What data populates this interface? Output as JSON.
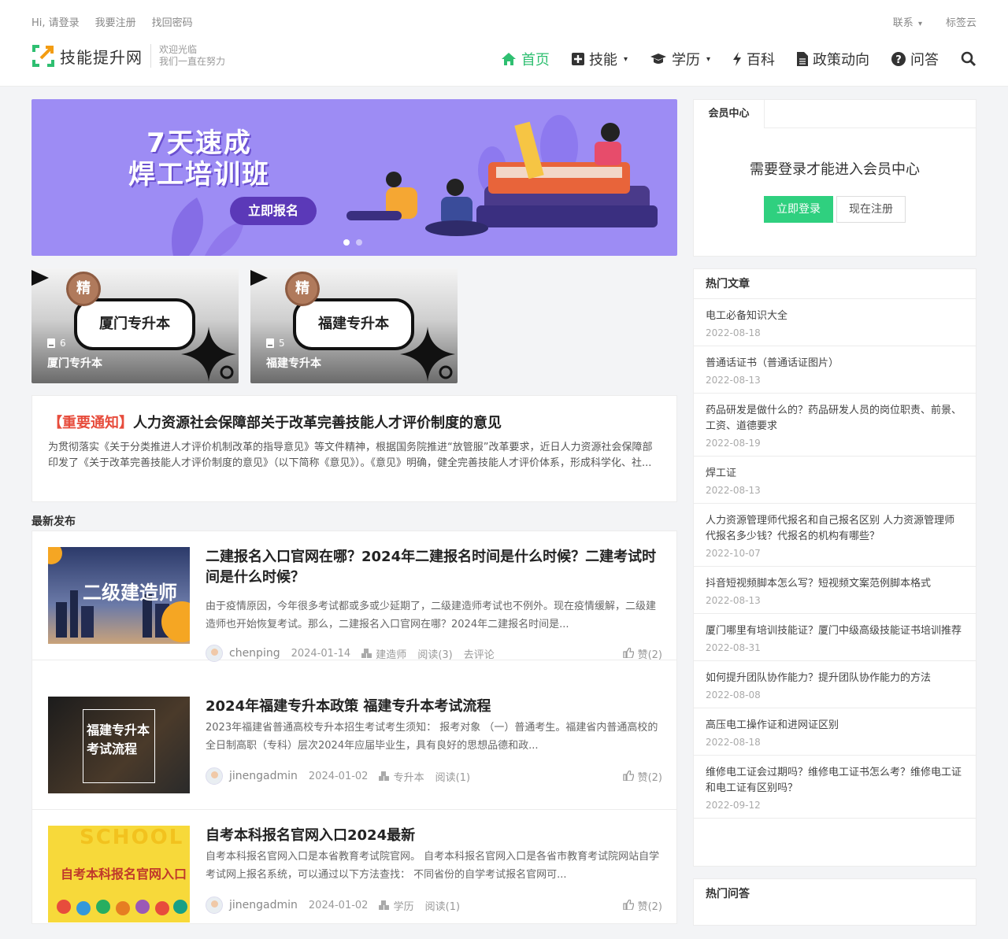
{
  "topbar": {
    "greeting": "Hi, 请登录",
    "register": "我要注册",
    "recover": "找回密码",
    "contact": "联系",
    "tagcloud": "标签云"
  },
  "logo": {
    "name": "技能提升网",
    "slogan1": "欢迎光临",
    "slogan2": "我们一直在努力"
  },
  "nav": [
    {
      "label": "首页",
      "icon": "home-icon",
      "active": true
    },
    {
      "label": "技能",
      "icon": "plus-square-icon",
      "dropdown": true
    },
    {
      "label": "学历",
      "icon": "graduation-cap-icon",
      "dropdown": true
    },
    {
      "label": "百科",
      "icon": "bolt-icon"
    },
    {
      "label": "政策动向",
      "icon": "file-icon"
    },
    {
      "label": "问答",
      "icon": "question-circle-icon"
    }
  ],
  "banner": {
    "title_line1": "7天速成",
    "title_line2": "焊工培训班",
    "button": "立即报名"
  },
  "categories": [
    {
      "pill": "厦门专升本",
      "medal": "精",
      "count": "6",
      "name": "厦门专升本"
    },
    {
      "pill": "福建专升本",
      "medal": "精",
      "count": "5",
      "name": "福建专升本"
    }
  ],
  "notice": {
    "tag": "【重要通知】",
    "title": "人力资源社会保障部关于改革完善技能人才评价制度的意见",
    "text": "为贯彻落实《关于分类推进人才评价机制改革的指导意见》等文件精神，根据国务院推进“放管服”改革要求，近日人力资源社会保障部印发了《关于改革完善技能人才评价制度的意见》（以下简称《意见》）。《意见》明确，健全完善技能人才评价体系，形成科学化、社..."
  },
  "latest_label": "最新发布",
  "posts": [
    {
      "thumb_text": "二级建造师",
      "title": "二建报名入口官网在哪？2024年二建报名时间是什么时候？二建考试时间是什么时候？",
      "excerpt": "由于疫情原因，今年很多考试都或多或少延期了，二级建造师考试也不例外。现在疫情缓解，二级建造师也开始恢复考试。那么，二建报名入口官网在哪？2024年二建报名时间是...",
      "author": "chenping",
      "date": "2024-01-14",
      "category": "建造师",
      "reads": "阅读(3)",
      "comment": "去评论",
      "likes": "赞(2)"
    },
    {
      "thumb_text": "福建专升本考试流程",
      "title": "2024年福建专升本政策 福建专升本考试流程",
      "excerpt": "2023年福建省普通高校专升本招生考试考生须知： 报考对象 （一）普通考生。福建省内普通高校的全日制高职（专科）层次2024年应届毕业生，具有良好的思想品德和政...",
      "author": "jinengadmin",
      "date": "2024-01-02",
      "category": "专升本",
      "reads": "阅读(1)",
      "likes": "赞(2)"
    },
    {
      "thumb_text": "自考本科报名官网入口",
      "thumb_banner": "SCHOOL",
      "title": "自考本科报名官网入口2024最新",
      "excerpt": "自考本科报名官网入口是本省教育考试院官网。 自考本科报名官网入口是各省市教育考试院网站自学考试网上报名系统，可以通过以下方法查找： 不同省份的自学考试报名官网可...",
      "author": "jinengadmin",
      "date": "2024-01-02",
      "category": "学历",
      "reads": "阅读(1)",
      "likes": "赞(2)"
    }
  ],
  "member": {
    "tab": "会员中心",
    "message": "需要登录才能进入会员中心",
    "login": "立即登录",
    "register": "现在注册"
  },
  "hot": {
    "title": "热门文章",
    "items": [
      {
        "title": "电工必备知识大全",
        "date": "2022-08-18"
      },
      {
        "title": "普通话证书（普通话证图片）",
        "date": "2022-08-13"
      },
      {
        "title": "药品研发是做什么的？药品研发人员的岗位职责、前景、工资、道德要求",
        "date": "2022-08-19"
      },
      {
        "title": "焊工证",
        "date": "2022-08-13"
      },
      {
        "title": "人力资源管理师代报名和自己报名区别 人力资源管理师代报名多少钱？代报名的机构有哪些？",
        "date": "2022-10-07"
      },
      {
        "title": "抖音短视频脚本怎么写？短视频文案范例脚本格式",
        "date": "2022-08-13"
      },
      {
        "title": "厦门哪里有培训技能证？厦门中级高级技能证书培训推荐",
        "date": "2022-08-31"
      },
      {
        "title": "如何提升团队协作能力？提升团队协作能力的方法",
        "date": "2022-08-08"
      },
      {
        "title": "高压电工操作证和进网证区别",
        "date": "2022-08-18"
      },
      {
        "title": "维修电工证会过期吗？维修电工证书怎么考？维修电工证和电工证有区别吗？",
        "date": "2022-09-12"
      }
    ]
  },
  "hotqa": {
    "title": "热门问答"
  },
  "colors": {
    "accent": "#2fbf71",
    "notice_tag": "#e74c3c",
    "login_btn": "#2fd07f",
    "banner_bg": "#9d8cf4"
  }
}
